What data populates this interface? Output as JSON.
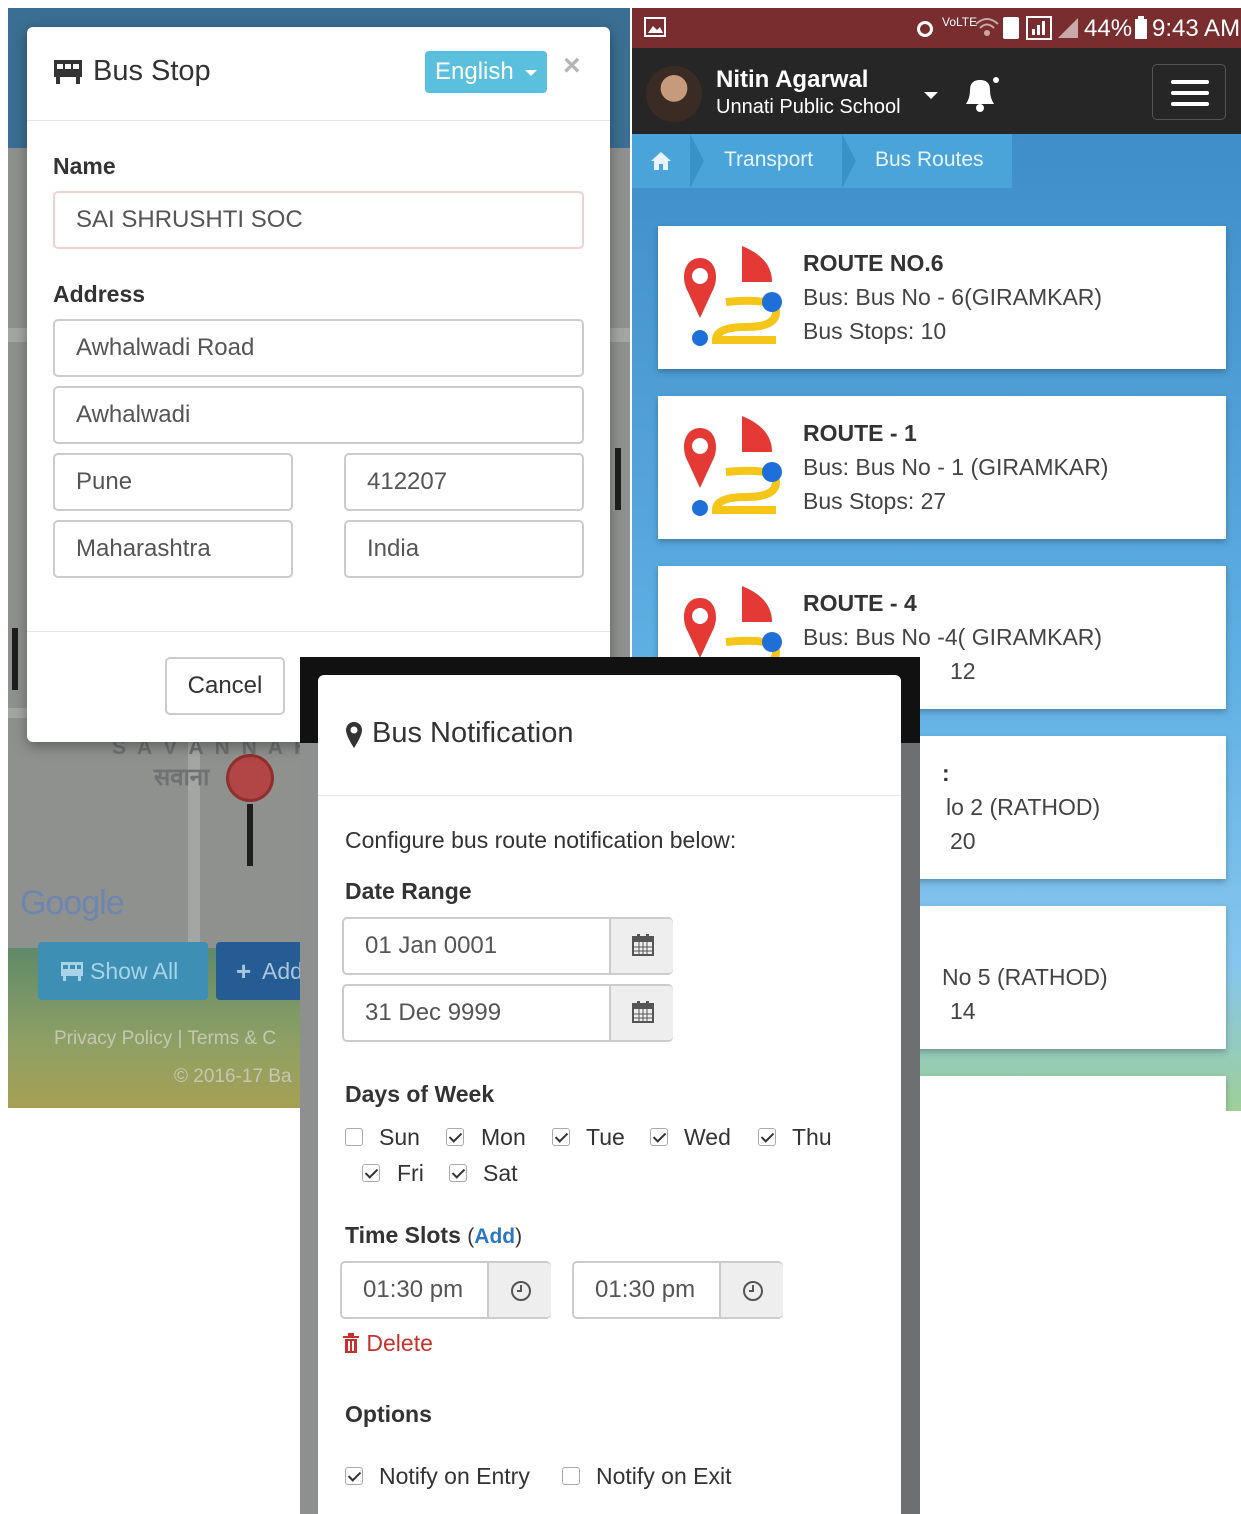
{
  "bus_stop_modal": {
    "title": "Bus Stop",
    "language": "English",
    "close": "×",
    "name_label": "Name",
    "name_value": "SAI SHRUSHTI SOC",
    "address_label": "Address",
    "address_line1": "Awhalwadi Road",
    "address_line2": "Awhalwadi",
    "city": "Pune",
    "pincode": "412207",
    "state": "Maharashtra",
    "country": "India",
    "cancel_label": "Cancel"
  },
  "left_background": {
    "map_label_en": "S A V A N N A H",
    "map_label_local": "सवाना",
    "google_logo": "Google",
    "show_all_label": "Show All",
    "add_label": "Add",
    "footer_links": "Privacy Policy | Terms & C",
    "footer_copyright": "© 2016-17 Ba"
  },
  "status_bar": {
    "battery": "44%",
    "time": "9:43 AM",
    "network": "VoLTE"
  },
  "app_header": {
    "user_name": "Nitin Agarwal",
    "school": "Unnati Public School"
  },
  "breadcrumb": {
    "items": [
      "Transport",
      "Bus Routes"
    ]
  },
  "routes": [
    {
      "title": "ROUTE NO.6",
      "bus": "Bus: Bus No - 6(GIRAMKAR)",
      "stops": "Bus Stops: 10"
    },
    {
      "title": "ROUTE - 1",
      "bus": "Bus: Bus No - 1 (GIRAMKAR)",
      "stops": "Bus Stops: 27"
    },
    {
      "title": "ROUTE - 4",
      "bus": "Bus: Bus No -4( GIRAMKAR)",
      "stops": "12"
    },
    {
      "title": ":",
      "bus": "lo 2 (RATHOD)",
      "stops": "20"
    },
    {
      "title": "",
      "bus": "No 5 (RATHOD)",
      "stops": "14"
    }
  ],
  "bus_notification": {
    "title": "Bus Notification",
    "description": "Configure bus route notification below:",
    "date_range_label": "Date Range",
    "date_from": "01 Jan 0001",
    "date_to": "31 Dec 9999",
    "days_label": "Days of Week",
    "days": [
      {
        "label": "Sun",
        "checked": false
      },
      {
        "label": "Mon",
        "checked": true
      },
      {
        "label": "Tue",
        "checked": true
      },
      {
        "label": "Wed",
        "checked": true
      },
      {
        "label": "Thu",
        "checked": true
      },
      {
        "label": "Fri",
        "checked": true
      },
      {
        "label": "Sat",
        "checked": true
      }
    ],
    "time_slots_label": "Time Slots",
    "add_label": "Add",
    "time_from": "01:30 pm",
    "time_to": "01:30 pm",
    "delete_label": "Delete",
    "options_label": "Options",
    "notify_entry_label": "Notify on Entry",
    "notify_entry_checked": true,
    "notify_exit_label": "Notify on Exit",
    "notify_exit_checked": false
  },
  "colors": {
    "language_button": "#5bc0de",
    "status_bar": "#7a2d2f",
    "app_bar": "#262626",
    "link": "#2a77c4",
    "delete": "#c9302c"
  }
}
